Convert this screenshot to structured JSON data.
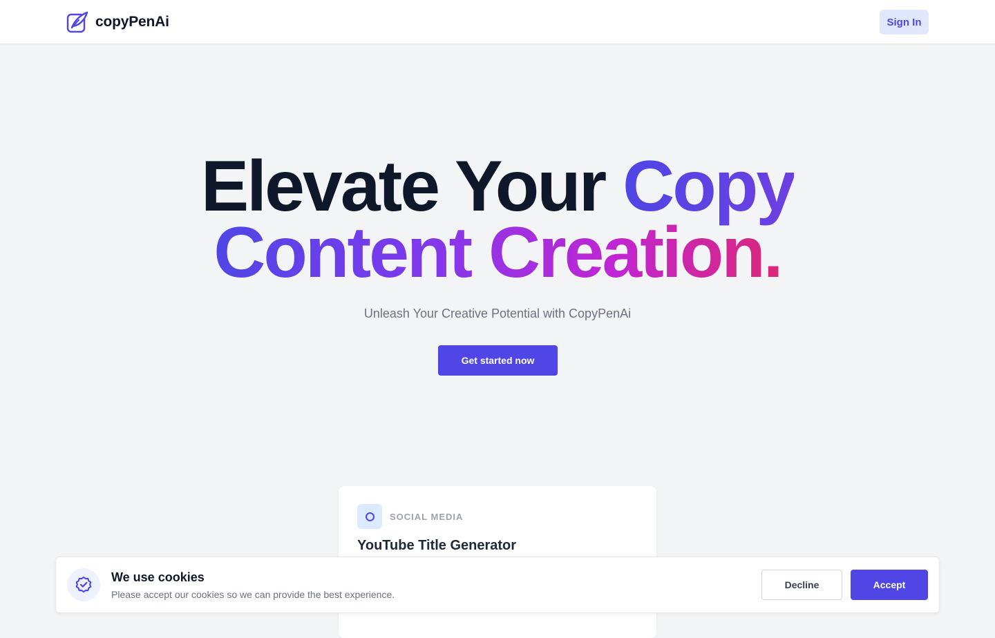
{
  "header": {
    "brand": "copyPenAi",
    "logo_icon": "feather-pen-icon",
    "sign_in_label": "Sign In"
  },
  "hero": {
    "title_dark": "Elevate Your",
    "title_accent_1": "Copy",
    "title_line_2": "Content Creation.",
    "subtitle": "Unleash Your Creative Potential with CopyPenAi",
    "cta_label": "Get started now"
  },
  "card": {
    "icon": "circle-icon",
    "category": "SOCIAL MEDIA",
    "title": "YouTube Title Generator"
  },
  "cookie": {
    "icon": "badge-check-icon",
    "title": "We use cookies",
    "text": "Please accept our cookies so we can provide the best experience.",
    "decline_label": "Decline",
    "accept_label": "Accept"
  },
  "colors": {
    "brand": "#4f46e5",
    "brand_light": "#e0e7ff",
    "gradient_start": "#4f46e5",
    "gradient_end": "#db2777",
    "background": "#f3f4f6"
  }
}
